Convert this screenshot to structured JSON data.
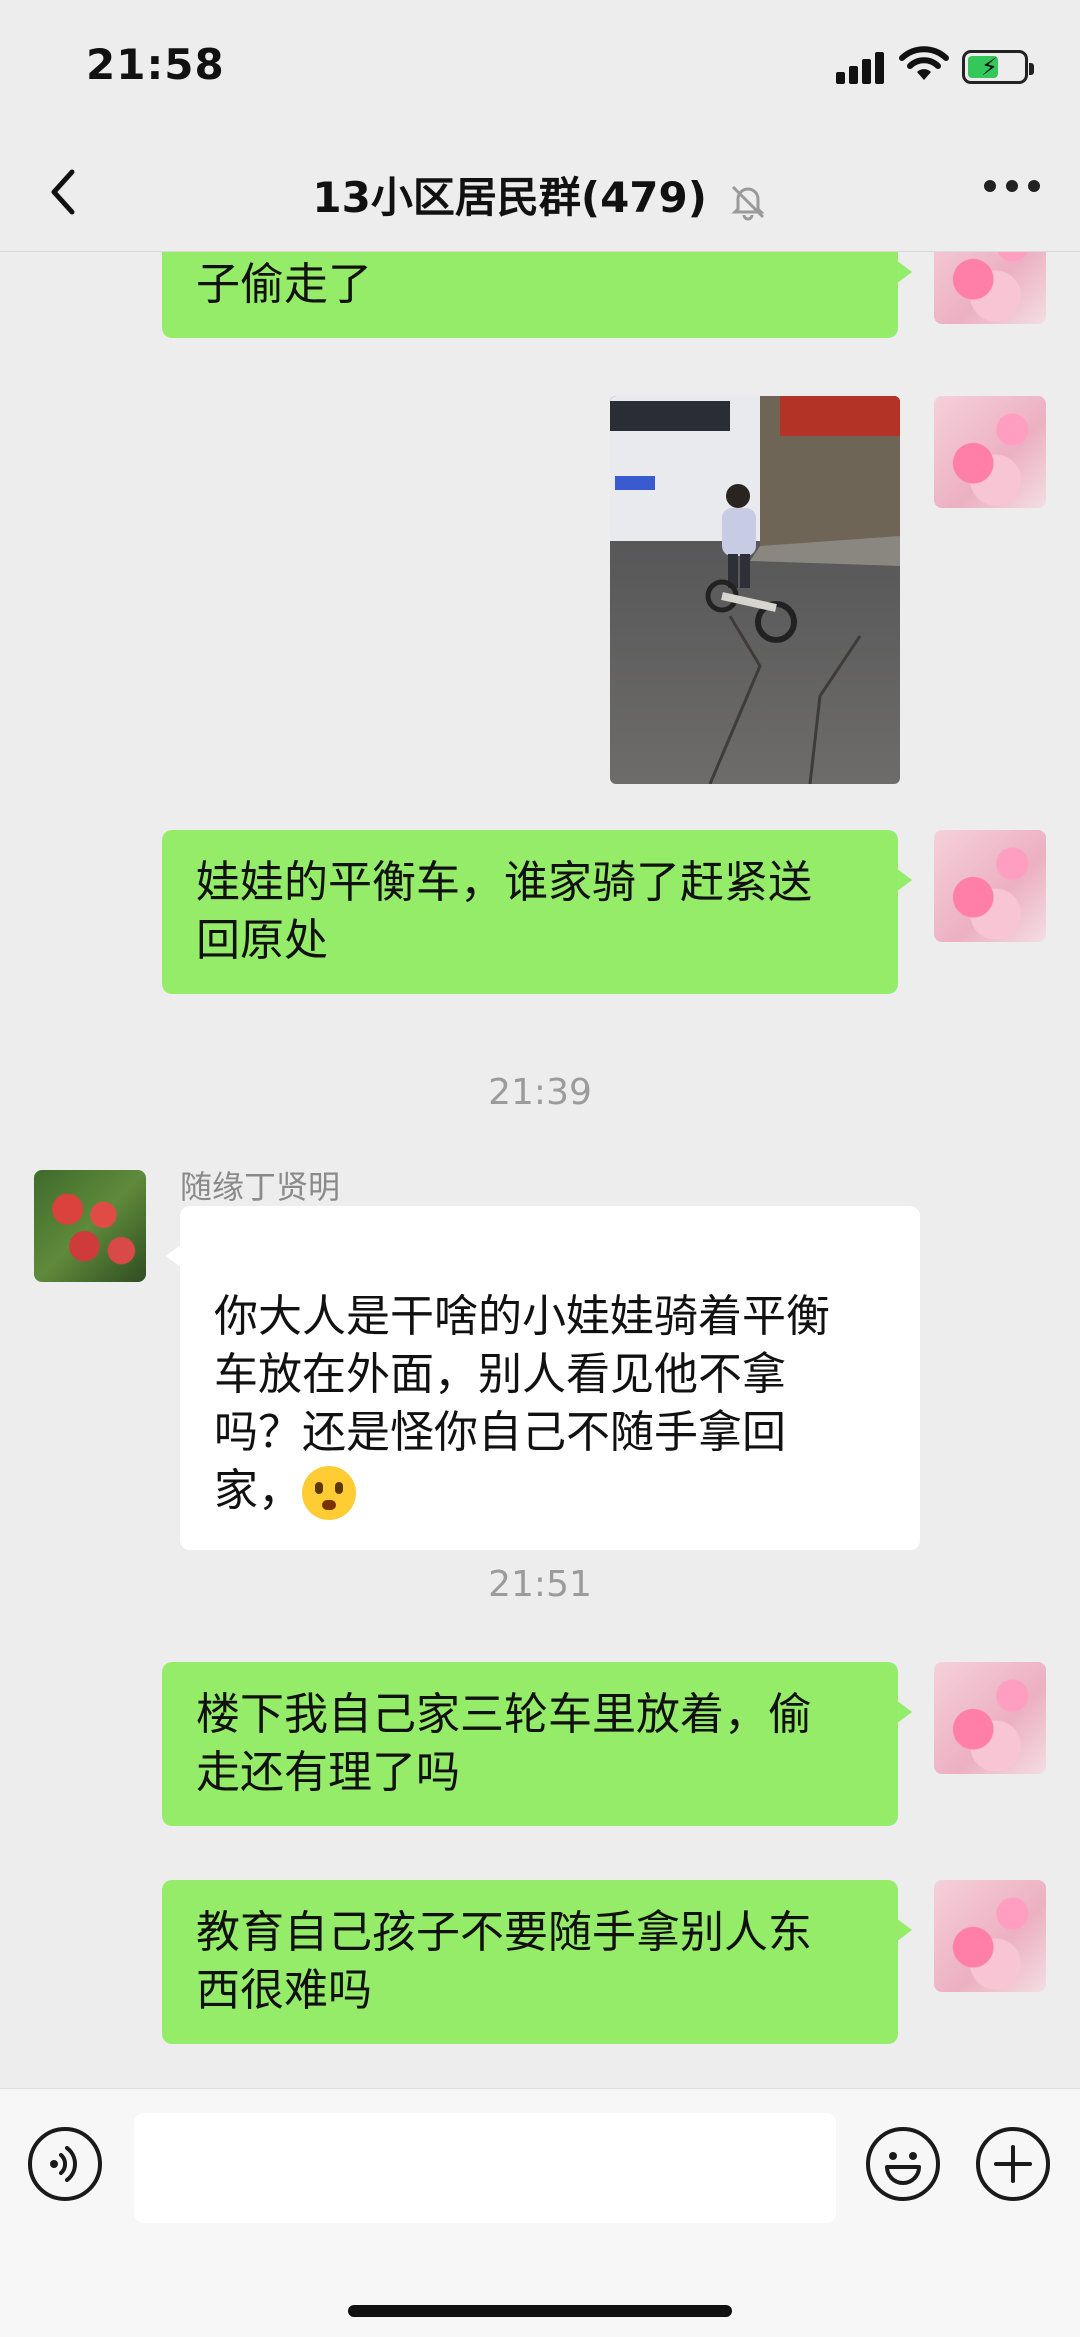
{
  "status_bar": {
    "time": "21:58",
    "battery_charging": true
  },
  "nav": {
    "title": "13小区居民群(479)",
    "muted": true
  },
  "messages": [
    {
      "type": "text",
      "from": "me",
      "text": "子偷走了"
    },
    {
      "type": "image",
      "from": "me"
    },
    {
      "type": "text",
      "from": "me",
      "text": "娃娃的平衡车，谁家骑了赶紧送\n回原处"
    },
    {
      "type": "time",
      "text": "21:39"
    },
    {
      "type": "text",
      "from": "other",
      "sender": "随缘丁贤明",
      "text": "你大人是干啥的小娃娃骑着平衡\n车放在外面，别人看见他不拿\n吗？还是怪你自己不随手拿回\n家，"
    },
    {
      "type": "time",
      "text": "21:51"
    },
    {
      "type": "text",
      "from": "me",
      "text": "楼下我自己家三轮车里放着，偷\n走还有理了吗"
    },
    {
      "type": "text",
      "from": "me",
      "text": "教育自己孩子不要随手拿别人东\n西很难吗"
    }
  ],
  "input": {
    "value": "",
    "placeholder": ""
  },
  "icons": {
    "voice": "voice-icon",
    "emoji": "emoji-icon",
    "plus": "plus-icon"
  },
  "colors": {
    "my_bubble": "#95ec69",
    "their_bubble": "#ffffff",
    "background": "#ededed"
  }
}
